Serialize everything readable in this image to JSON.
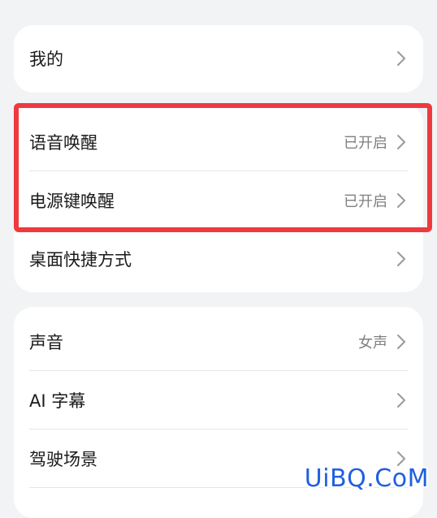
{
  "sections": [
    {
      "items": [
        {
          "label": "我的",
          "value": ""
        }
      ]
    },
    {
      "items": [
        {
          "label": "语音唤醒",
          "value": "已开启"
        },
        {
          "label": "电源键唤醒",
          "value": "已开启"
        },
        {
          "label": "桌面快捷方式",
          "value": ""
        }
      ]
    },
    {
      "items": [
        {
          "label": "声音",
          "value": "女声"
        },
        {
          "label": "AI 字幕",
          "value": ""
        },
        {
          "label": "驾驶场景",
          "value": ""
        }
      ]
    }
  ],
  "watermark": "UiBQ.CoM",
  "colors": {
    "highlight": "#ee3a3f",
    "background": "#f1f3f5",
    "watermark": "#1f5fe0"
  },
  "icons": {
    "row_arrow": "chevron-right-icon"
  }
}
